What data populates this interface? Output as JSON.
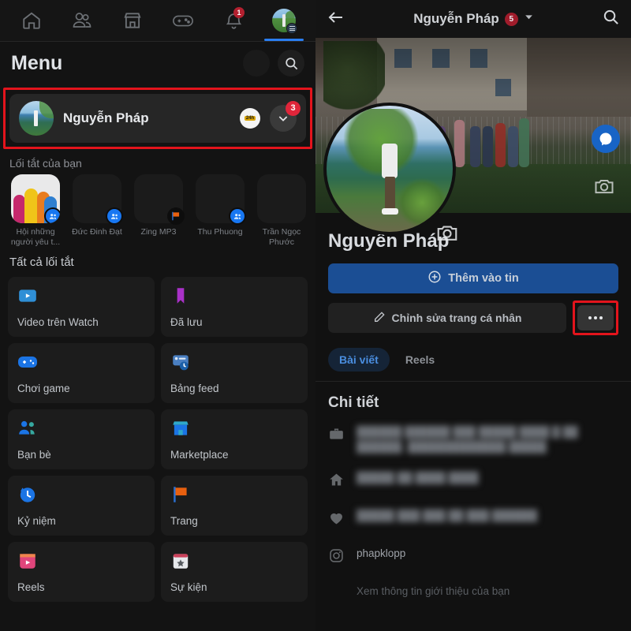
{
  "left": {
    "topnav": {
      "items": [
        {
          "name": "home",
          "icon": "home-icon",
          "badge": ""
        },
        {
          "name": "friends",
          "icon": "friends-icon",
          "badge": ""
        },
        {
          "name": "marketplace",
          "icon": "marketplace-icon",
          "badge": ""
        },
        {
          "name": "gaming",
          "icon": "gaming-icon",
          "badge": ""
        },
        {
          "name": "notifications",
          "icon": "bell-icon",
          "badge": "1"
        },
        {
          "name": "menu-profile",
          "icon": "profile-avatar-icon",
          "badge": ""
        }
      ]
    },
    "header": {
      "title": "Menu",
      "settings_icon": "settings-circle-icon",
      "search_icon": "search-icon"
    },
    "profile": {
      "name": "Nguyễn Pháp",
      "story_badge": "24h",
      "notification_count": "3",
      "chevron_icon": "chevron-down-icon"
    },
    "shortcuts_label": "Lối tắt của bạn",
    "shortcuts": [
      {
        "label": "Hội những người yêu t...",
        "badge": "group-icon"
      },
      {
        "label": "Đức Đinh Đạt",
        "badge": "group-icon"
      },
      {
        "label": "Zing MP3",
        "badge": "page-flag-icon"
      },
      {
        "label": "Thu Phuong",
        "badge": "group-icon"
      },
      {
        "label": "Trần Ngọc Phước",
        "badge": "group-icon"
      }
    ],
    "all_shortcuts_label": "Tất cả lối tắt",
    "tiles": [
      {
        "label": "Video trên Watch",
        "icon": "watch-video-icon"
      },
      {
        "label": "Đã lưu",
        "icon": "bookmark-saved-icon"
      },
      {
        "label": "Chơi game",
        "icon": "gaming-icon"
      },
      {
        "label": "Bảng feed",
        "icon": "feeds-icon"
      },
      {
        "label": "Bạn bè",
        "icon": "friends-icon"
      },
      {
        "label": "Marketplace",
        "icon": "marketplace-icon"
      },
      {
        "label": "Kỷ niệm",
        "icon": "memories-clock-icon"
      },
      {
        "label": "Trang",
        "icon": "pages-flag-icon"
      },
      {
        "label": "Reels",
        "icon": "reels-icon"
      },
      {
        "label": "Sự kiện",
        "icon": "events-calendar-icon"
      }
    ]
  },
  "right": {
    "topbar": {
      "back_icon": "back-arrow-icon",
      "title": "Nguyễn Pháp",
      "title_badge": "5",
      "dropdown_icon": "chevron-down-icon",
      "search_icon": "search-icon"
    },
    "cover": {
      "camera_icon": "camera-icon",
      "messenger_icon": "messenger-icon"
    },
    "avatar": {
      "camera_icon": "camera-icon"
    },
    "profile_name": "Nguyễn Pháp",
    "buttons": {
      "add_story": "Thêm vào tin",
      "add_story_icon": "plus-circle-icon",
      "edit_profile": "Chỉnh sửa trang cá nhân",
      "edit_icon": "pencil-icon",
      "more_icon": "more-dots-icon"
    },
    "tabs": [
      {
        "label": "Bài viết",
        "active": true
      },
      {
        "label": "Reels",
        "active": false
      }
    ],
    "details_title": "Chi tiết",
    "details": [
      {
        "icon": "briefcase-icon",
        "text": "██████ ██████ ███ █████ ████ █ ██ ██████, █████████████ █████",
        "blurred": true
      },
      {
        "icon": "home-solid-icon",
        "text": "█████ ██ ████ ████",
        "blurred": true
      },
      {
        "icon": "heart-icon",
        "text": "█████ ███ ███ ██ ███ ██████",
        "blurred": true
      },
      {
        "icon": "instagram-icon",
        "text": "phapklopp",
        "blurred": false
      }
    ],
    "details_footer": "Xem thông tin giới thiệu của bạn"
  },
  "colors": {
    "highlight": "#e3141c",
    "accent_blue": "#1877f2",
    "badge_red": "#e0253a"
  }
}
